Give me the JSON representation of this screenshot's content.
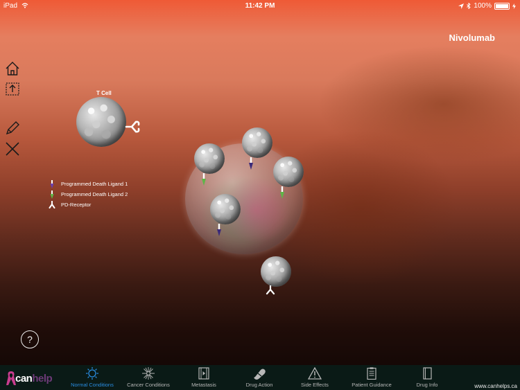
{
  "status_bar": {
    "device": "iPad",
    "time": "11:42 PM",
    "battery": "100%"
  },
  "drug_name": "Nivolumab",
  "scene": {
    "tcell_label": "T Cell"
  },
  "legend": [
    {
      "label": "Programmed Death Ligand 1",
      "color": "#6a3fb0"
    },
    {
      "label": "Programmed Death Ligand 2",
      "color": "#5fb548"
    },
    {
      "label": "PD-Receptor",
      "color": "#ffffff"
    }
  ],
  "help_label": "?",
  "tabbar": {
    "logo_text": "can",
    "logo_text_faded": "help",
    "tabs": [
      {
        "label": "Normal Conditions",
        "icon": "gear-sun-icon",
        "active": true
      },
      {
        "label": "Cancer Conditions",
        "icon": "burst-icon",
        "active": false
      },
      {
        "label": "Metastasis",
        "icon": "film-icon",
        "active": false
      },
      {
        "label": "Drug Action",
        "icon": "capsule-icon",
        "active": false
      },
      {
        "label": "Side Effects",
        "icon": "warning-icon",
        "active": false
      },
      {
        "label": "Patient Guidance",
        "icon": "clipboard-icon",
        "active": false
      },
      {
        "label": "Drug Info",
        "icon": "book-icon",
        "active": false
      }
    ],
    "website": "www.canhelps.ca"
  },
  "colors": {
    "accent": "#2a8de2",
    "tabbar_bg": "#0a1a16"
  }
}
